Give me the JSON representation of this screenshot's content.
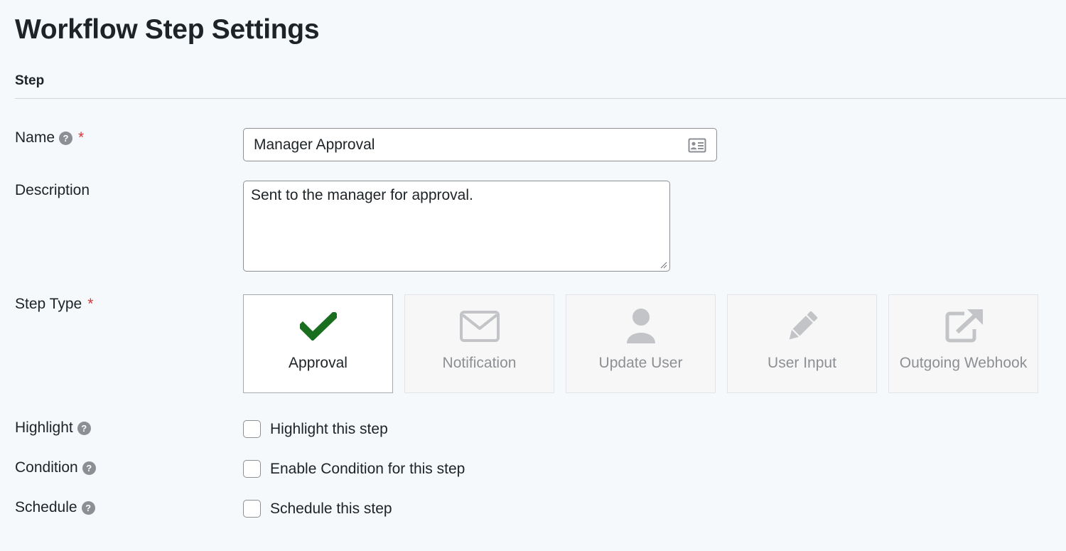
{
  "page": {
    "title": "Workflow Step Settings"
  },
  "section": {
    "heading": "Step"
  },
  "fields": {
    "name": {
      "label": "Name",
      "required_mark": "*",
      "help_icon": "question-circle-icon",
      "value": "Manager Approval",
      "icon": "contact-card-icon"
    },
    "description": {
      "label": "Description",
      "value": "Sent to the manager for approval."
    },
    "step_type": {
      "label": "Step Type",
      "required_mark": "*",
      "selected": "Approval",
      "options": [
        {
          "label": "Approval",
          "icon": "checkmark-icon",
          "selected": true,
          "icon_color": "#1a6e1f"
        },
        {
          "label": "Notification",
          "icon": "envelope-icon",
          "selected": false
        },
        {
          "label": "Update User",
          "icon": "user-icon",
          "selected": false
        },
        {
          "label": "User Input",
          "icon": "pencil-icon",
          "selected": false
        },
        {
          "label": "Outgoing Webhook",
          "icon": "external-link-icon",
          "selected": false
        }
      ]
    },
    "highlight": {
      "label": "Highlight",
      "help_icon": "question-circle-icon",
      "checkbox_label": "Highlight this step",
      "checked": false
    },
    "condition": {
      "label": "Condition",
      "help_icon": "question-circle-icon",
      "checkbox_label": "Enable Condition for this step",
      "checked": false
    },
    "schedule": {
      "label": "Schedule",
      "help_icon": "question-circle-icon",
      "checkbox_label": "Schedule this step",
      "checked": false
    }
  },
  "colors": {
    "background": "#f5f9fb",
    "required": "#d63638",
    "approval_check": "#1a6e1f",
    "inactive_icon": "#c3c4c7"
  }
}
